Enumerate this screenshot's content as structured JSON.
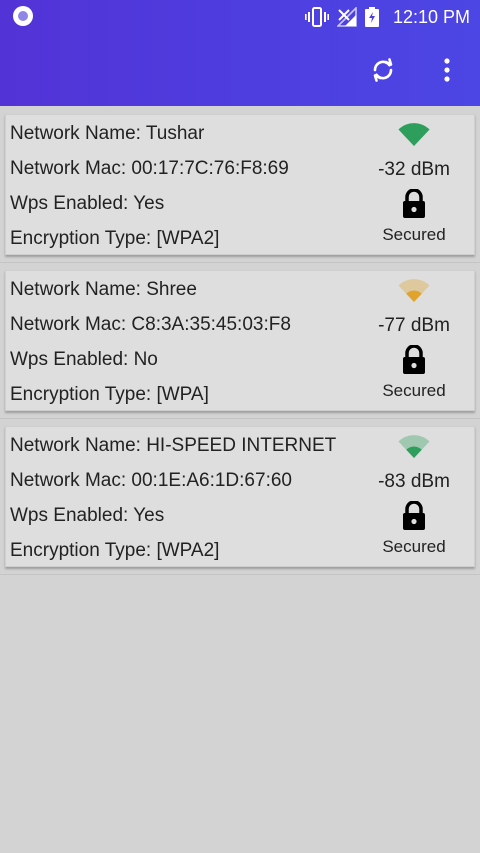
{
  "status_bar": {
    "time": "12:10 PM",
    "icons": [
      "app-notification-icon",
      "vibrate-icon",
      "no-signal-icon",
      "battery-charging-icon"
    ]
  },
  "toolbar": {
    "refresh_icon": "refresh-icon",
    "menu_icon": "more-vert-icon"
  },
  "networks": [
    {
      "name_line": "Network Name: Tushar",
      "mac_line": "Network Mac: 00:17:7C:76:F8:69",
      "wps_line": "Wps Enabled: Yes",
      "enc_line": "Encryption Type: [WPA2]",
      "signal": "-32 dBm",
      "security": "Secured",
      "signal_color": "#2e9e5c",
      "signal_bars": 4
    },
    {
      "name_line": "Network Name: Shree",
      "mac_line": "Network Mac: C8:3A:35:45:03:F8",
      "wps_line": "Wps Enabled: No",
      "enc_line": "Encryption Type: [WPA]",
      "signal": "-77 dBm",
      "security": "Secured",
      "signal_color": "#e0a32c",
      "signal_bars": 2
    },
    {
      "name_line": "Network Name: HI-SPEED INTERNET",
      "mac_line": "Network Mac: 00:1E:A6:1D:67:60",
      "wps_line": "Wps Enabled: Yes",
      "enc_line": "Encryption Type: [WPA2]",
      "signal": "-83 dBm",
      "security": "Secured",
      "signal_color": "#2e9e5c",
      "signal_bars": 2
    }
  ]
}
